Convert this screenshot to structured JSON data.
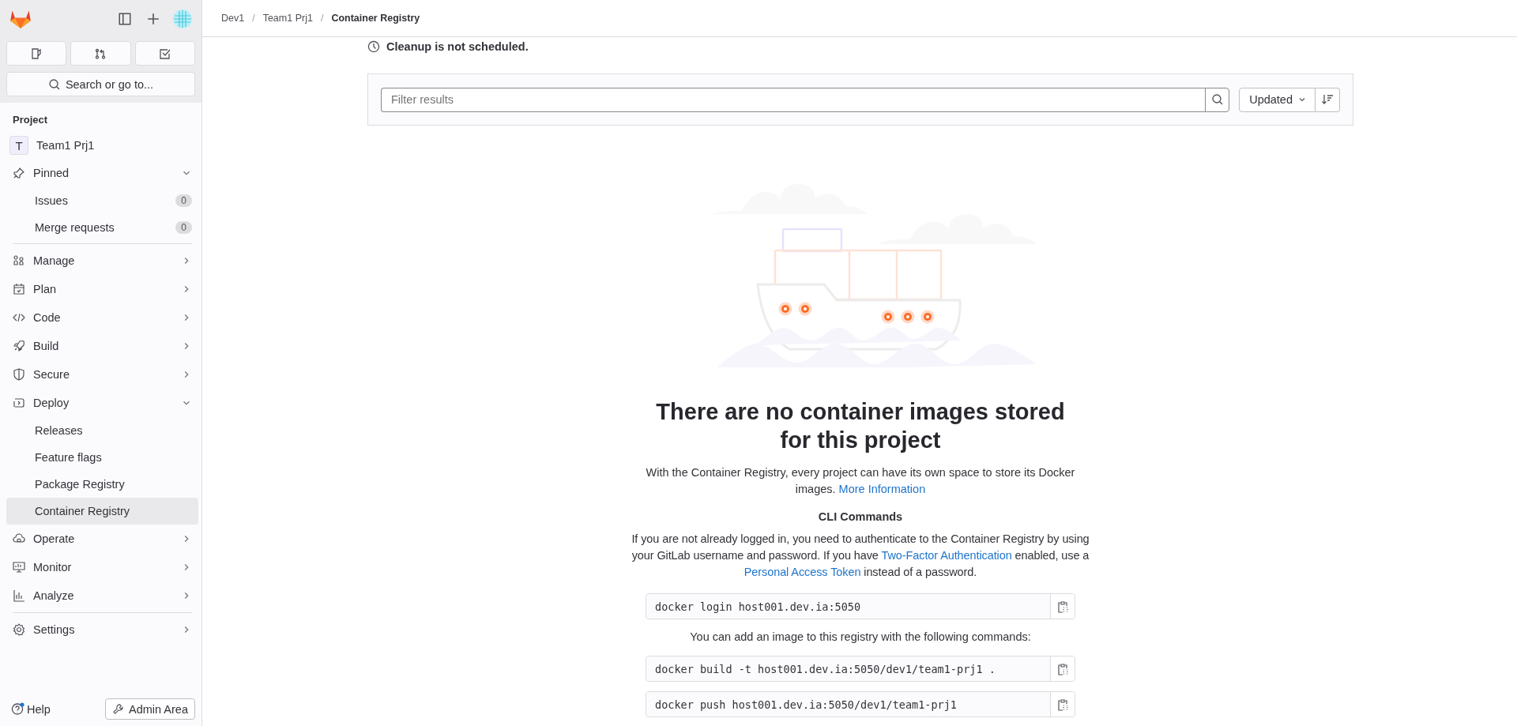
{
  "sidebar": {
    "search_button": "Search or go to...",
    "section_label": "Project",
    "project": {
      "avatar_letter": "T",
      "name": "Team1 Prj1"
    },
    "sections": [
      [
        {
          "label": "Pinned",
          "expanded": true,
          "children": [
            {
              "label": "Issues",
              "count": "0",
              "selected": false
            },
            {
              "label": "Merge requests",
              "count": "0",
              "selected": false
            }
          ]
        }
      ],
      [
        {
          "label": "Manage",
          "expanded": false
        },
        {
          "label": "Plan",
          "expanded": false
        },
        {
          "label": "Code",
          "expanded": false
        },
        {
          "label": "Build",
          "expanded": false
        },
        {
          "label": "Secure",
          "expanded": false
        },
        {
          "label": "Deploy",
          "expanded": true,
          "children": [
            {
              "label": "Releases",
              "selected": false
            },
            {
              "label": "Feature flags",
              "selected": false
            },
            {
              "label": "Package Registry",
              "selected": false
            },
            {
              "label": "Container Registry",
              "selected": true
            }
          ]
        },
        {
          "label": "Operate",
          "expanded": false
        },
        {
          "label": "Monitor",
          "expanded": false
        },
        {
          "label": "Analyze",
          "expanded": false
        }
      ],
      [
        {
          "label": "Settings",
          "expanded": false
        }
      ]
    ],
    "help": "Help",
    "help_notification": true,
    "admin_button": "Admin Area"
  },
  "breadcrumbs": [
    {
      "label": "Dev1",
      "current": false
    },
    {
      "separator": "/",
      "label": "Team1 Prj1",
      "current": false
    },
    {
      "separator": "/",
      "label": "Container Registry",
      "current": true
    }
  ],
  "cleanup_status": "Cleanup is not scheduled.",
  "filter": {
    "placeholder": "Filter results",
    "sort": "Updated"
  },
  "empty_state": {
    "title": "There are no container images stored for this project",
    "description": [
      {
        "kind": "text",
        "text": "With the Container Registry, every project can have its own space to store its Docker images. "
      },
      {
        "kind": "link",
        "text": "More Information"
      }
    ],
    "cli_heading": "CLI Commands",
    "login_help": [
      {
        "kind": "text",
        "text": "If you are not already logged in, you need to authenticate to the Container Registry by using your GitLab username and password. If you have "
      },
      {
        "kind": "link",
        "text": "Two-Factor Authentication"
      },
      {
        "kind": "text",
        "text": " enabled, use a "
      },
      {
        "kind": "link",
        "text": "Personal Access Token"
      },
      {
        "kind": "text",
        "text": " instead of a password."
      }
    ],
    "login_command": "docker login host001.dev.ia:5050",
    "add_image_note": "You can add an image to this registry with the following commands:",
    "push_commands": [
      "docker build -t host001.dev.ia:5050/dev1/team1-prj1 .",
      "docker push host001.dev.ia:5050/dev1/team1-prj1"
    ]
  }
}
